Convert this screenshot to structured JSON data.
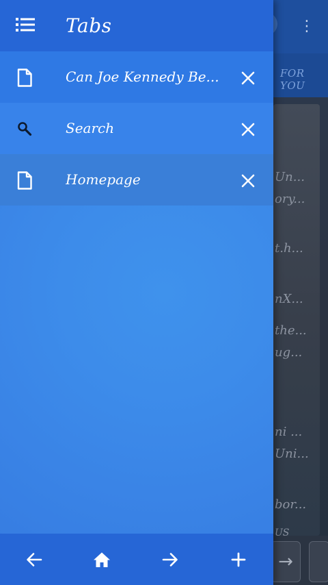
{
  "drawer": {
    "title": "Tabs",
    "tabs": [
      {
        "icon": "page-icon",
        "title": "Can Joe Kennedy Be...",
        "close": "close-icon"
      },
      {
        "icon": "search-icon",
        "title": "Search",
        "close": "close-icon"
      },
      {
        "icon": "page-icon",
        "title": "Homepage",
        "close": "close-icon"
      }
    ],
    "footer": {
      "back": "arrow-back-icon",
      "home": "home-icon",
      "forward": "arrow-forward-icon",
      "add": "plus-icon"
    }
  },
  "background": {
    "tabbar_label": "FOR YOU",
    "overflow_glyph": "⋮",
    "forward_glyph": "→",
    "snippets": [
      "Un...",
      "ory...",
      "t.h...",
      "nX...",
      "the...",
      "ug...",
      "ni ...",
      "Uni...",
      "bor...",
      "US"
    ]
  },
  "colors": {
    "drawer_header": "#2666d6",
    "drawer_body": "#3a84e6",
    "selected_row": "#3a7fd8",
    "text": "#ffffff"
  }
}
